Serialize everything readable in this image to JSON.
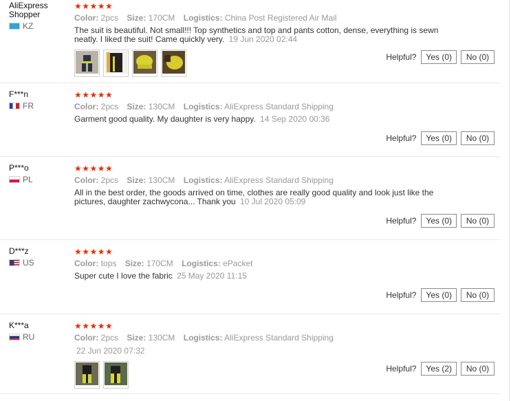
{
  "labels": {
    "color": "Color:",
    "size": "Size:",
    "logistics": "Logistics:",
    "helpful": "Helpful?"
  },
  "colors": {
    "star": "#e62e04",
    "meta_text": "#999999",
    "body_text": "#333333"
  },
  "reviews": [
    {
      "user": "AliExpress Shopper",
      "country": "KZ",
      "stars": "★★★★★",
      "rating": 5,
      "color_value": "2pcs",
      "size_value": "170CM",
      "logistics_value": "China Post Registered Air Mail",
      "text": "The suit is beautiful. Not small!!! Top synthetics and top and pants cotton, dense, everything is sewn neatly. I liked the suit! Came quickly very.",
      "date": "19 Jun 2020 02:44",
      "yes": "Yes (0)",
      "no": "No (0)",
      "photo_count": 4
    },
    {
      "user": "F***n",
      "country": "FR",
      "stars": "★★★★★",
      "rating": 5,
      "color_value": "2pcs",
      "size_value": "130CM",
      "logistics_value": "AliExpress Standard Shipping",
      "text": "Garment good quality. My daughter is very happy.",
      "date": "14 Sep 2020 00:36",
      "yes": "Yes (0)",
      "no": "No (0)"
    },
    {
      "user": "P***o",
      "country": "PL",
      "stars": "★★★★★",
      "rating": 5,
      "color_value": "2pcs",
      "size_value": "130CM",
      "logistics_value": "AliExpress Standard Shipping",
      "text": "All in the best order, the goods arrived on time, clothes are really good quality and look just like the pictures, daughter zachwycona... Thank you",
      "date": "10 Jul 2020 05:09",
      "yes": "Yes (0)",
      "no": "No (0)"
    },
    {
      "user": "D***z",
      "country": "US",
      "stars": "★★★★★",
      "rating": 5,
      "color_value": "tops",
      "size_value": "170CM",
      "logistics_value": "ePacket",
      "text": "Super cute I love the fabric",
      "date": "25 May 2020 11:15",
      "yes": "Yes (0)",
      "no": "No (0)"
    },
    {
      "user": "K***a",
      "country": "RU",
      "stars": "★★★★★",
      "rating": 5,
      "color_value": "2pcs",
      "size_value": "130CM",
      "logistics_value": "AliExpress Standard Shipping",
      "text": "",
      "date": "22 Jun 2020 07:32",
      "yes": "Yes (2)",
      "no": "No (0)",
      "photo_count": 2
    }
  ]
}
